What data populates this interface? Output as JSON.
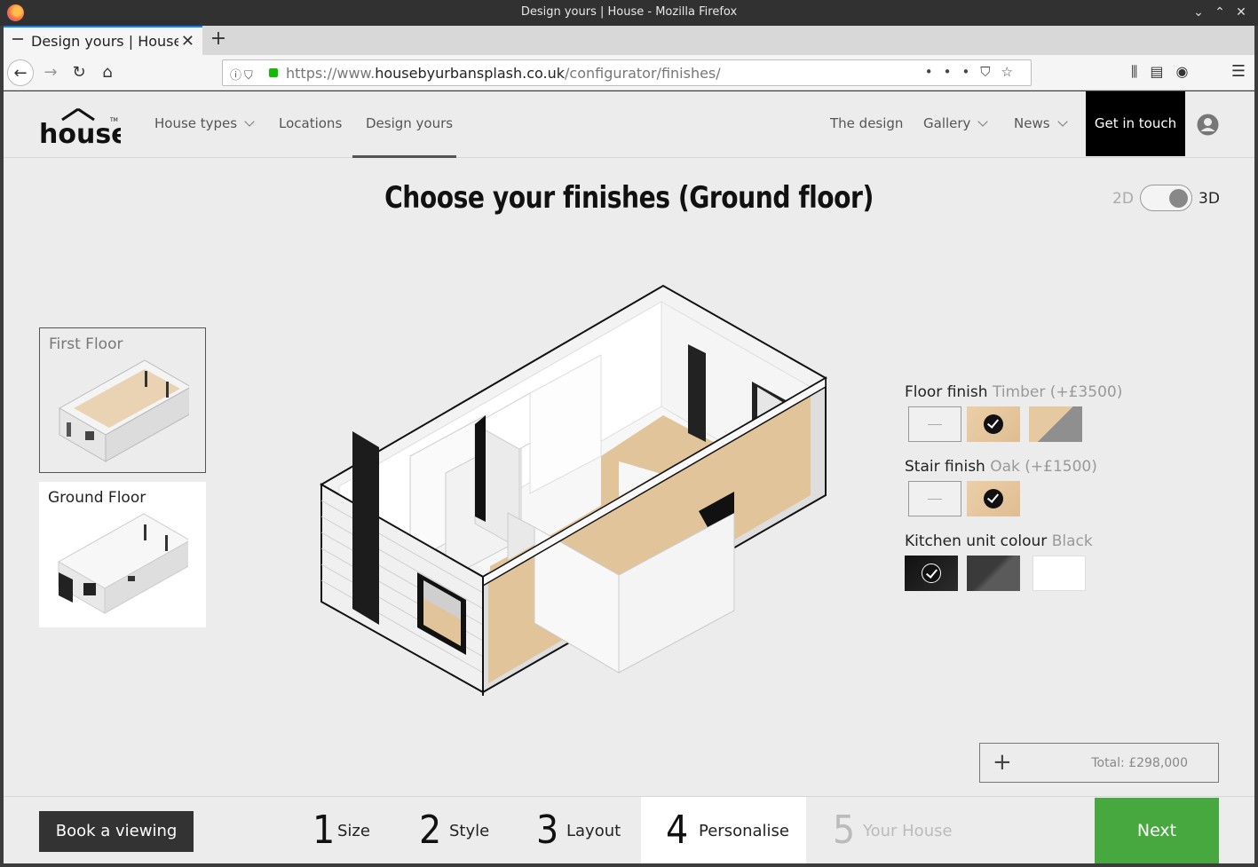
{
  "window": {
    "title": "Design yours | House - Mozilla Firefox"
  },
  "tab": {
    "label": "Design yours | House"
  },
  "urlbar": {
    "url_prefix": "https://www.",
    "url_domain": "housebyurbansplash.co.uk",
    "url_path": "/configurator/finishes/"
  },
  "site": {
    "nav": {
      "house_types": "House types",
      "locations": "Locations",
      "design_yours": "Design yours",
      "the_design": "The design",
      "gallery": "Gallery",
      "news": "News",
      "get_in_touch": "Get in touch"
    }
  },
  "main": {
    "heading": "Choose your finishes (Ground floor)",
    "view_toggle": {
      "left": "2D",
      "right": "3D",
      "selected": "3D"
    }
  },
  "floors": [
    {
      "label": "First Floor",
      "active": false
    },
    {
      "label": "Ground Floor",
      "active": true
    }
  ],
  "options": {
    "floor_finish": {
      "label": "Floor finish",
      "selected": "Timber (+£3500)"
    },
    "stair_finish": {
      "label": "Stair finish",
      "selected": "Oak (+£1500)"
    },
    "kitchen_colour": {
      "label": "Kitchen unit colour",
      "selected": "Black"
    }
  },
  "total": {
    "label": "Total: £298,000"
  },
  "bottom": {
    "book_viewing": "Book a viewing",
    "steps": [
      {
        "num": "1",
        "label": "Size"
      },
      {
        "num": "2",
        "label": "Style"
      },
      {
        "num": "3",
        "label": "Layout"
      },
      {
        "num": "4",
        "label": "Personalise"
      },
      {
        "num": "5",
        "label": "Your House"
      }
    ],
    "next": "Next"
  },
  "colors": {
    "accent_green": "#46a83e",
    "timber": "#e5c9a0"
  }
}
